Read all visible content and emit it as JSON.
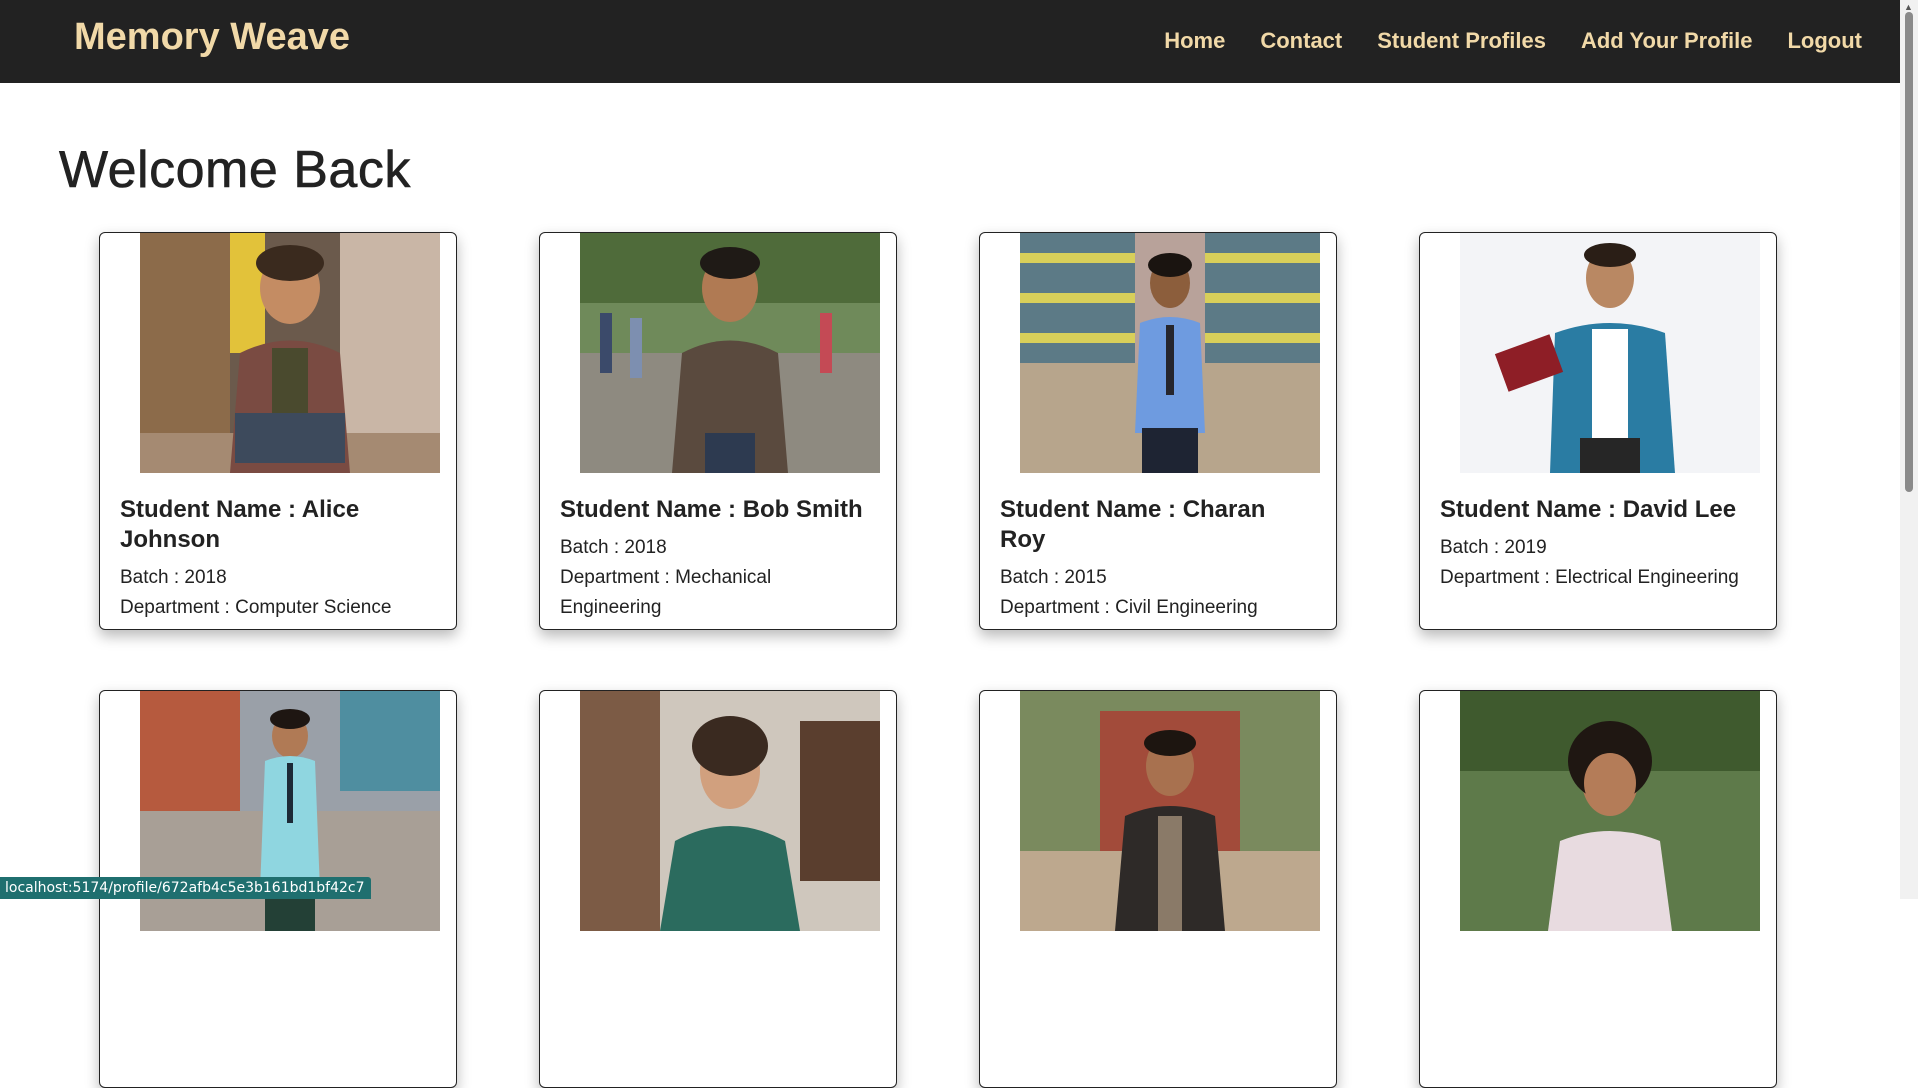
{
  "navbar": {
    "brand": "Memory Weave",
    "links": [
      "Home",
      "Contact",
      "Student Profiles",
      "Add Your Profile",
      "Logout"
    ]
  },
  "page": {
    "title": "Welcome Back"
  },
  "labels": {
    "name_prefix": "Student Name : ",
    "batch_prefix": "Batch : ",
    "dept_prefix": "Department : "
  },
  "students": [
    {
      "name": "Alice Johnson",
      "batch": "2018",
      "department": "Computer Science"
    },
    {
      "name": "Bob Smith",
      "batch": "2018",
      "department": "Mechanical Engineering"
    },
    {
      "name": "Charan Roy",
      "batch": "2015",
      "department": "Civil Engineering"
    },
    {
      "name": "David Lee",
      "batch": "2019",
      "department": "Electrical Engineering"
    }
  ],
  "status_bar": {
    "url": "localhost:5174/profile/672afb4c5e3b161bd1bf42c7"
  },
  "colors": {
    "navbar_bg": "#222222",
    "nav_text": "#f1d9a8",
    "status_bg": "#1f6f6f"
  }
}
